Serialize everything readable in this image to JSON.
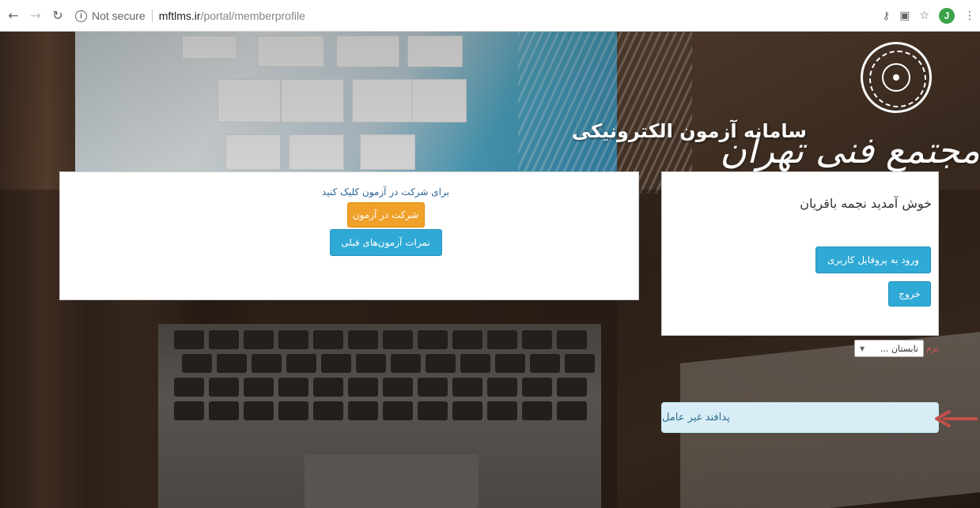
{
  "browser": {
    "security_label": "Not secure",
    "url_host": "mftlms.ir",
    "url_path": "/portal/memberprofile",
    "avatar_letter": "J"
  },
  "header": {
    "site_title": "سامانه آزمون الکترونیکی",
    "logo_script": "مجتمع فنی تهران"
  },
  "exam_panel": {
    "hint": "برای شرکت در آزمون کلیک کنید",
    "take_exam_label": "شرکت در آزمون",
    "previous_scores_label": "نمرات آزمون‌های قبلی"
  },
  "user_panel": {
    "welcome": "خوش آمدید نجمه باقریان",
    "profile_label": "ورود به پروفایل کاربری",
    "logout_label": "خروج"
  },
  "term": {
    "label": "ترم",
    "selected": "تابستان ..."
  },
  "defense_link": {
    "label": "پدافند غیر عامل"
  },
  "colors": {
    "orange_button": "#f0a12a",
    "blue_button": "#2fa9d5",
    "info_bar": "#d9edf7",
    "annotation_arrow": "#c0504d"
  }
}
